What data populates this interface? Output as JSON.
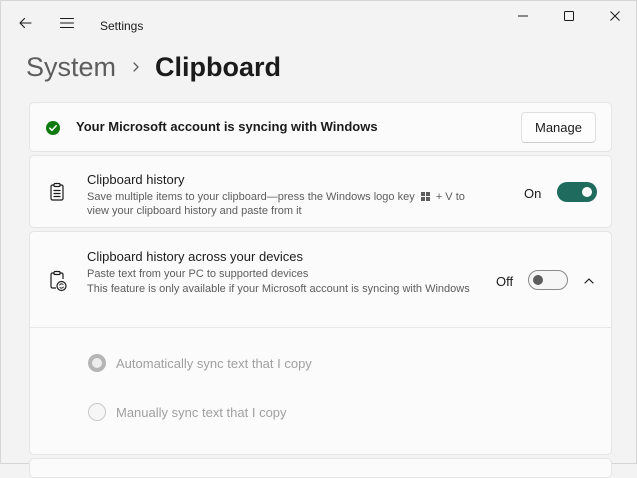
{
  "window": {
    "title": "Settings",
    "controls": {
      "minimize": "minimize-icon",
      "maximize": "maximize-icon",
      "close": "close-icon"
    }
  },
  "breadcrumb": {
    "parent": "System",
    "current": "Clipboard"
  },
  "sync_banner": {
    "text": "Your Microsoft account is syncing with Windows",
    "button": "Manage",
    "status_color": "#0f7b0f"
  },
  "clipboard_history": {
    "title": "Clipboard history",
    "description_1": "Save multiple items to your clipboard—press the Windows logo key",
    "description_2": "+ V to",
    "description_3": "view your clipboard history and paste from it",
    "toggle_label": "On",
    "enabled": true
  },
  "across_devices": {
    "title": "Clipboard history across your devices",
    "description": "Paste text from your PC to supported devices",
    "note": "This feature is only available if your Microsoft account is syncing with Windows",
    "toggle_label": "Off",
    "enabled": false,
    "expanded": true,
    "options": [
      {
        "label": "Automatically sync text that I copy",
        "selected": true,
        "disabled": true
      },
      {
        "label": "Manually sync text that I copy",
        "selected": false,
        "disabled": true
      }
    ]
  },
  "accent_color": "#1f6b5e"
}
